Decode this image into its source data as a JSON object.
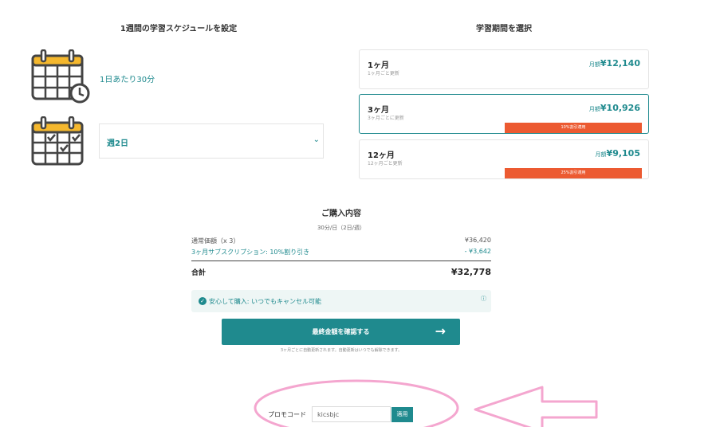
{
  "left": {
    "title": "1週間の学習スケジュールを設定",
    "duration_label": "1日あたり30分",
    "days_select_value": "週2日"
  },
  "right": {
    "title": "学習期間を選択",
    "plans": [
      {
        "name": "1ヶ月",
        "sub": "1ヶ月ごと更新",
        "price_prefix": "月額",
        "price": "¥12,140",
        "badge": ""
      },
      {
        "name": "3ヶ月",
        "sub": "3ヶ月ごとに更新",
        "price_prefix": "月額",
        "price": "¥10,926",
        "badge": "10%割引適用",
        "selected": true
      },
      {
        "name": "12ヶ月",
        "sub": "12ヶ月ごと更新",
        "price_prefix": "月額",
        "price": "¥9,105",
        "badge": "25%割引適用"
      }
    ]
  },
  "summary": {
    "title": "ご購入内容",
    "subtitle": "30分/日（2日/週）",
    "rows": [
      {
        "label": "通常価額（x 3）",
        "value": "¥36,420"
      },
      {
        "label": "3ヶ月サブスクリプション: 10%割り引き",
        "value": "- ¥3,642"
      }
    ],
    "total_label": "合計",
    "total_value": "¥32,778",
    "notice": "安心して購入: いつでもキャンセル可能",
    "notice_info": "ⓘ",
    "cta_label": "最終金額を確認する",
    "cta_arrow": "→",
    "footnote": "3ヶ月ごとに自動更新されます。自動更新はいつでも解除できます。"
  },
  "promo": {
    "label": "プロモコード",
    "value": "kicsbjc",
    "apply": "適用"
  },
  "colors": {
    "accent": "#1f8a8e",
    "badge": "#ec5a31",
    "annotation": "#f4a6cf",
    "calendar_top": "#f5b82e"
  },
  "icons": [
    "calendar-clock-icon",
    "calendar-check-icon",
    "chevron-down-icon",
    "check-circle-icon",
    "info-icon",
    "arrow-right-icon"
  ]
}
